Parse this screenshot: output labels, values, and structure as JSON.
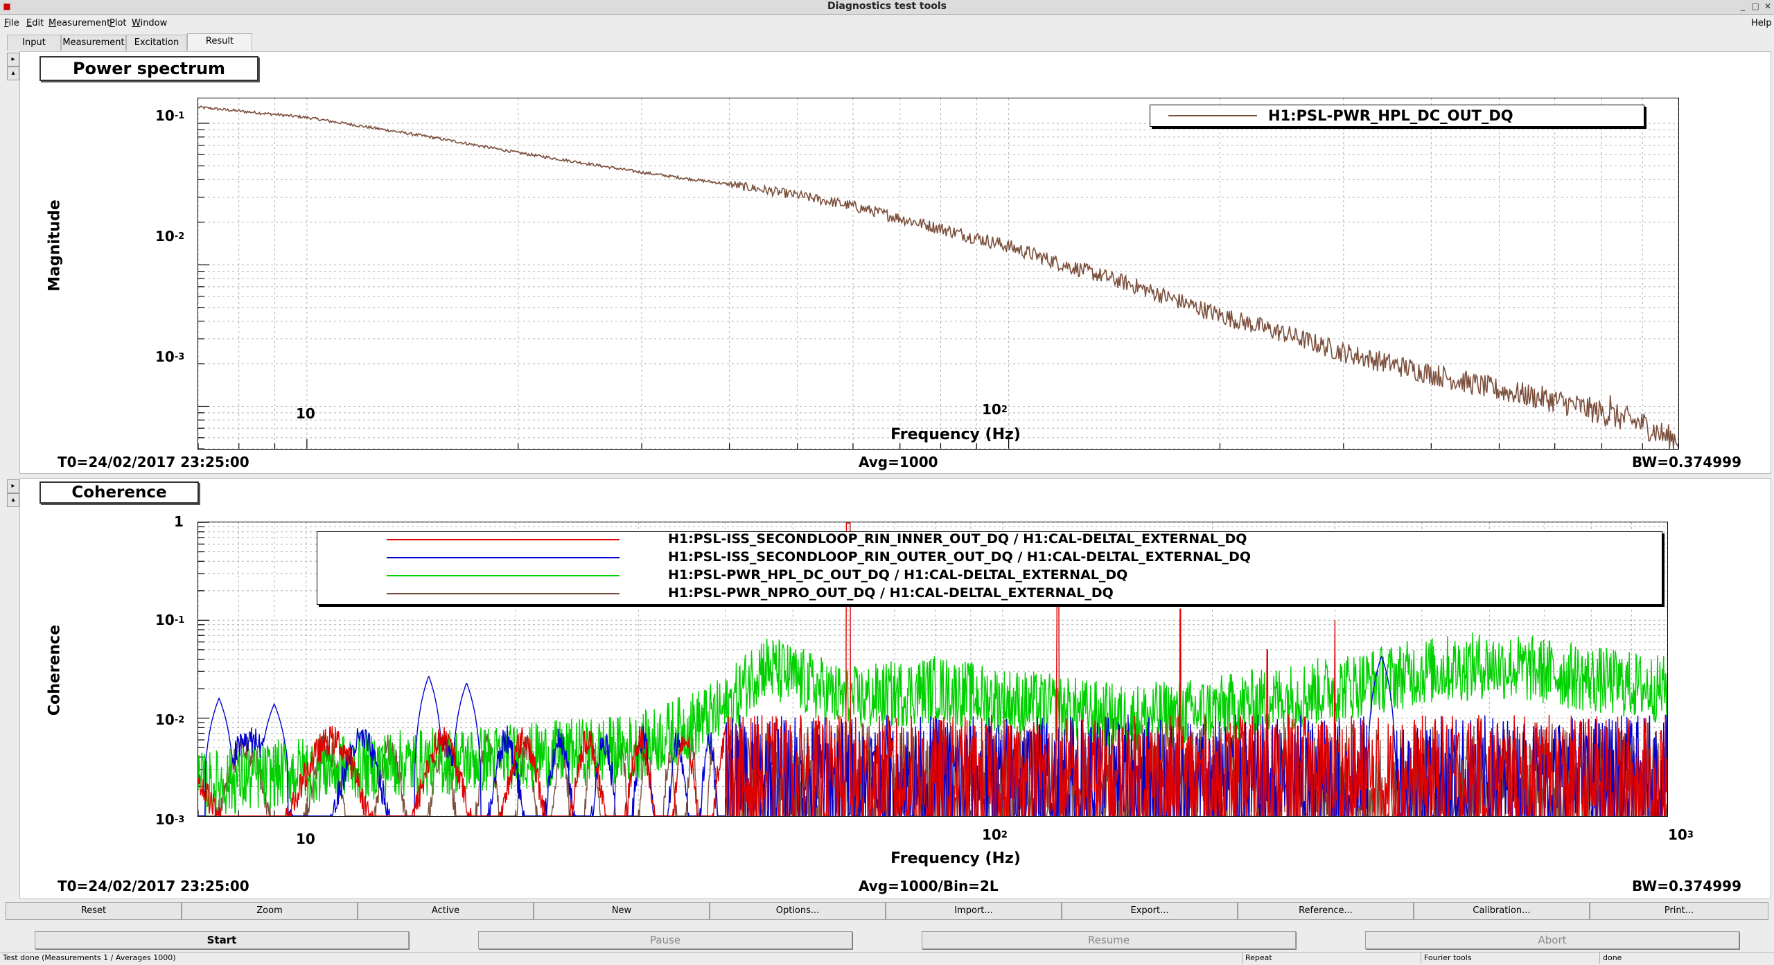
{
  "window": {
    "title": "Diagnostics test tools"
  },
  "menu": [
    {
      "label": "File",
      "u": "F",
      "rest": "ile"
    },
    {
      "label": "Edit",
      "u": "E",
      "rest": "dit"
    },
    {
      "label": "Measurement",
      "u": "M",
      "rest": "easurement"
    },
    {
      "label": "Plot",
      "u": "P",
      "rest": "lot"
    },
    {
      "label": "Window",
      "u": "W",
      "rest": "indow"
    }
  ],
  "help_label": "Help",
  "tabs": [
    "Input",
    "Measurement",
    "Excitation",
    "Result"
  ],
  "active_tab": "Result",
  "plot1": {
    "title": "Power spectrum",
    "ylabel": "Magnitude",
    "xlabel": "Frequency (Hz)",
    "info_left": "T0=24/02/2017 23:25:00",
    "info_center": "Avg=1000",
    "info_right": "BW=0.374999",
    "legend": [
      {
        "name": "H1:PSL-PWR_HPL_DC_OUT_DQ",
        "color": "#7b4f3c"
      }
    ]
  },
  "plot2": {
    "title": "Coherence",
    "ylabel": "Coherence",
    "xlabel": "Frequency (Hz)",
    "info_left": "T0=24/02/2017 23:25:00",
    "info_center": "Avg=1000/Bin=2L",
    "info_right": "BW=0.374999",
    "legend": [
      {
        "name": "H1:PSL-ISS_SECONDLOOP_RIN_INNER_OUT_DQ / H1:CAL-DELTAL_EXTERNAL_DQ",
        "color": "#e00000"
      },
      {
        "name": "H1:PSL-ISS_SECONDLOOP_RIN_OUTER_OUT_DQ / H1:CAL-DELTAL_EXTERNAL_DQ",
        "color": "#0000d0"
      },
      {
        "name": "H1:PSL-PWR_HPL_DC_OUT_DQ / H1:CAL-DELTAL_EXTERNAL_DQ",
        "color": "#00d000"
      },
      {
        "name": "H1:PSL-PWR_NPRO_OUT_DQ / H1:CAL-DELTAL_EXTERNAL_DQ",
        "color": "#7b4f3c"
      }
    ]
  },
  "chart_data": [
    {
      "type": "line",
      "title": "Power spectrum",
      "xlabel": "Frequency (Hz)",
      "ylabel": "Magnitude",
      "xscale": "log",
      "yscale": "log",
      "xlim": [
        7,
        900
      ],
      "ylim": [
        0.0005,
        0.15
      ],
      "x_ticks": [
        "10",
        "10^2"
      ],
      "y_ticks": [
        "10^-1",
        "10^-2",
        "10^-3"
      ],
      "grid": true,
      "legend_position": "top-right",
      "series": [
        {
          "name": "H1:PSL-PWR_HPL_DC_OUT_DQ",
          "color": "#7b4f3c",
          "x": [
            7,
            10,
            15,
            20,
            30,
            40,
            50,
            60,
            80,
            100,
            120,
            150,
            200,
            250,
            300,
            400,
            500,
            600,
            700,
            800,
            870
          ],
          "y": [
            0.13,
            0.11,
            0.08,
            0.062,
            0.045,
            0.037,
            0.031,
            0.026,
            0.018,
            0.0135,
            0.01,
            0.0072,
            0.0044,
            0.0032,
            0.0024,
            0.0017,
            0.0013,
            0.0011,
            0.0009,
            0.00075,
            0.0006
          ],
          "spikes": [
            {
              "x": 720,
              "y": 0.0012
            }
          ]
        }
      ]
    },
    {
      "type": "line",
      "title": "Coherence",
      "xlabel": "Frequency (Hz)",
      "ylabel": "Coherence",
      "xscale": "log",
      "yscale": "log",
      "xlim": [
        7,
        900
      ],
      "ylim": [
        0.001,
        1
      ],
      "x_ticks": [
        "10",
        "10^2",
        "10^3"
      ],
      "y_ticks": [
        "1",
        "10^-1",
        "10^-2",
        "10^-3"
      ],
      "grid": true,
      "legend_position": "top",
      "series": [
        {
          "name": "H1:PSL-ISS_SECONDLOOP_RIN_INNER_OUT_DQ / H1:CAL-DELTAL_EXTERNAL_DQ",
          "color": "#e00000",
          "floor": 0.003,
          "spikes": [
            {
              "x": 60,
              "y": 1.0
            },
            {
              "x": 120,
              "y": 0.15
            },
            {
              "x": 180,
              "y": 0.13
            },
            {
              "x": 240,
              "y": 0.05
            },
            {
              "x": 300,
              "y": 0.1
            }
          ]
        },
        {
          "name": "H1:PSL-ISS_SECONDLOOP_RIN_OUTER_OUT_DQ / H1:CAL-DELTAL_EXTERNAL_DQ",
          "color": "#0000d0",
          "floor": 0.003,
          "peaks": [
            {
              "x": 7.5,
              "y": 0.013
            },
            {
              "x": 9,
              "y": 0.011
            },
            {
              "x": 15,
              "y": 0.024
            },
            {
              "x": 17,
              "y": 0.02
            },
            {
              "x": 350,
              "y": 0.04
            }
          ]
        },
        {
          "name": "H1:PSL-PWR_HPL_DC_OUT_DQ / H1:CAL-DELTAL_EXTERNAL_DQ",
          "color": "#00d000",
          "x": [
            7,
            10,
            20,
            30,
            40,
            45,
            60,
            80,
            100,
            150,
            200,
            300,
            400,
            500,
            600,
            700,
            870
          ],
          "y": [
            0.002,
            0.003,
            0.004,
            0.005,
            0.012,
            0.035,
            0.015,
            0.02,
            0.015,
            0.01,
            0.012,
            0.02,
            0.03,
            0.035,
            0.03,
            0.025,
            0.02
          ]
        },
        {
          "name": "H1:PSL-PWR_NPRO_OUT_DQ / H1:CAL-DELTAL_EXTERNAL_DQ",
          "color": "#7b4f3c",
          "floor": 0.0025
        }
      ]
    }
  ],
  "bottom_buttons": [
    "Reset",
    "Zoom",
    "Active",
    "New",
    "Options...",
    "Import...",
    "Export...",
    "Reference...",
    "Calibration...",
    "Print..."
  ],
  "action_buttons": [
    {
      "label": "Start",
      "enabled": true
    },
    {
      "label": "Pause",
      "enabled": false
    },
    {
      "label": "Resume",
      "enabled": false
    },
    {
      "label": "Abort",
      "enabled": false
    }
  ],
  "status": {
    "main": "Test done (Measurements 1 / Averages 1000)",
    "mode": "Repeat",
    "tools": "Fourier tools",
    "state": "done"
  }
}
